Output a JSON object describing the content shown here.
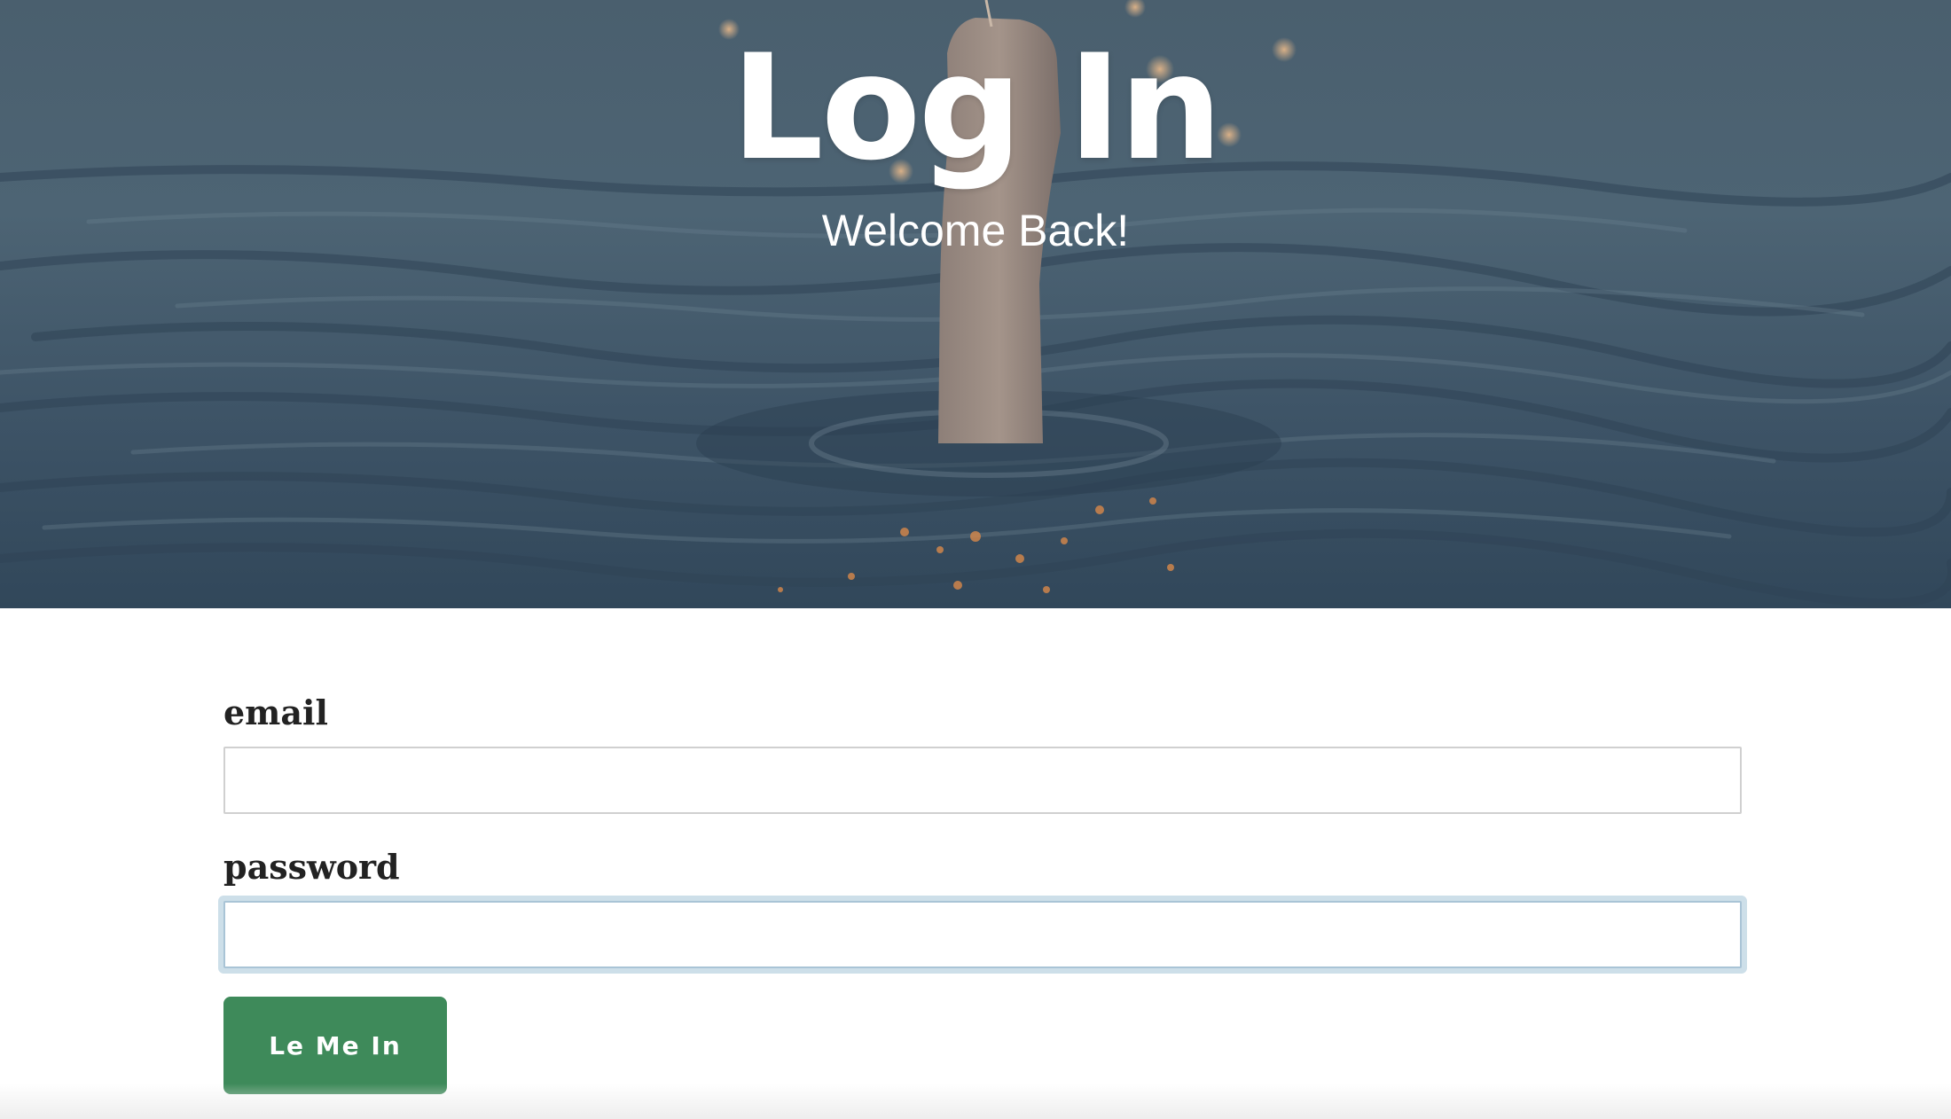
{
  "hero": {
    "title": "Log In",
    "subtitle": "Welcome Back!",
    "background_image": "hand-holding-sparkler-rising-from-sea"
  },
  "form": {
    "email_label": "email",
    "email_value": "",
    "password_label": "password",
    "password_value": "",
    "password_focused": true,
    "submit_label": "Le Me In"
  },
  "colors": {
    "button": "#3e8a5a",
    "focus_ring": "#cddfe9",
    "label_text": "#222222",
    "hero_overlay": "#41566a"
  }
}
